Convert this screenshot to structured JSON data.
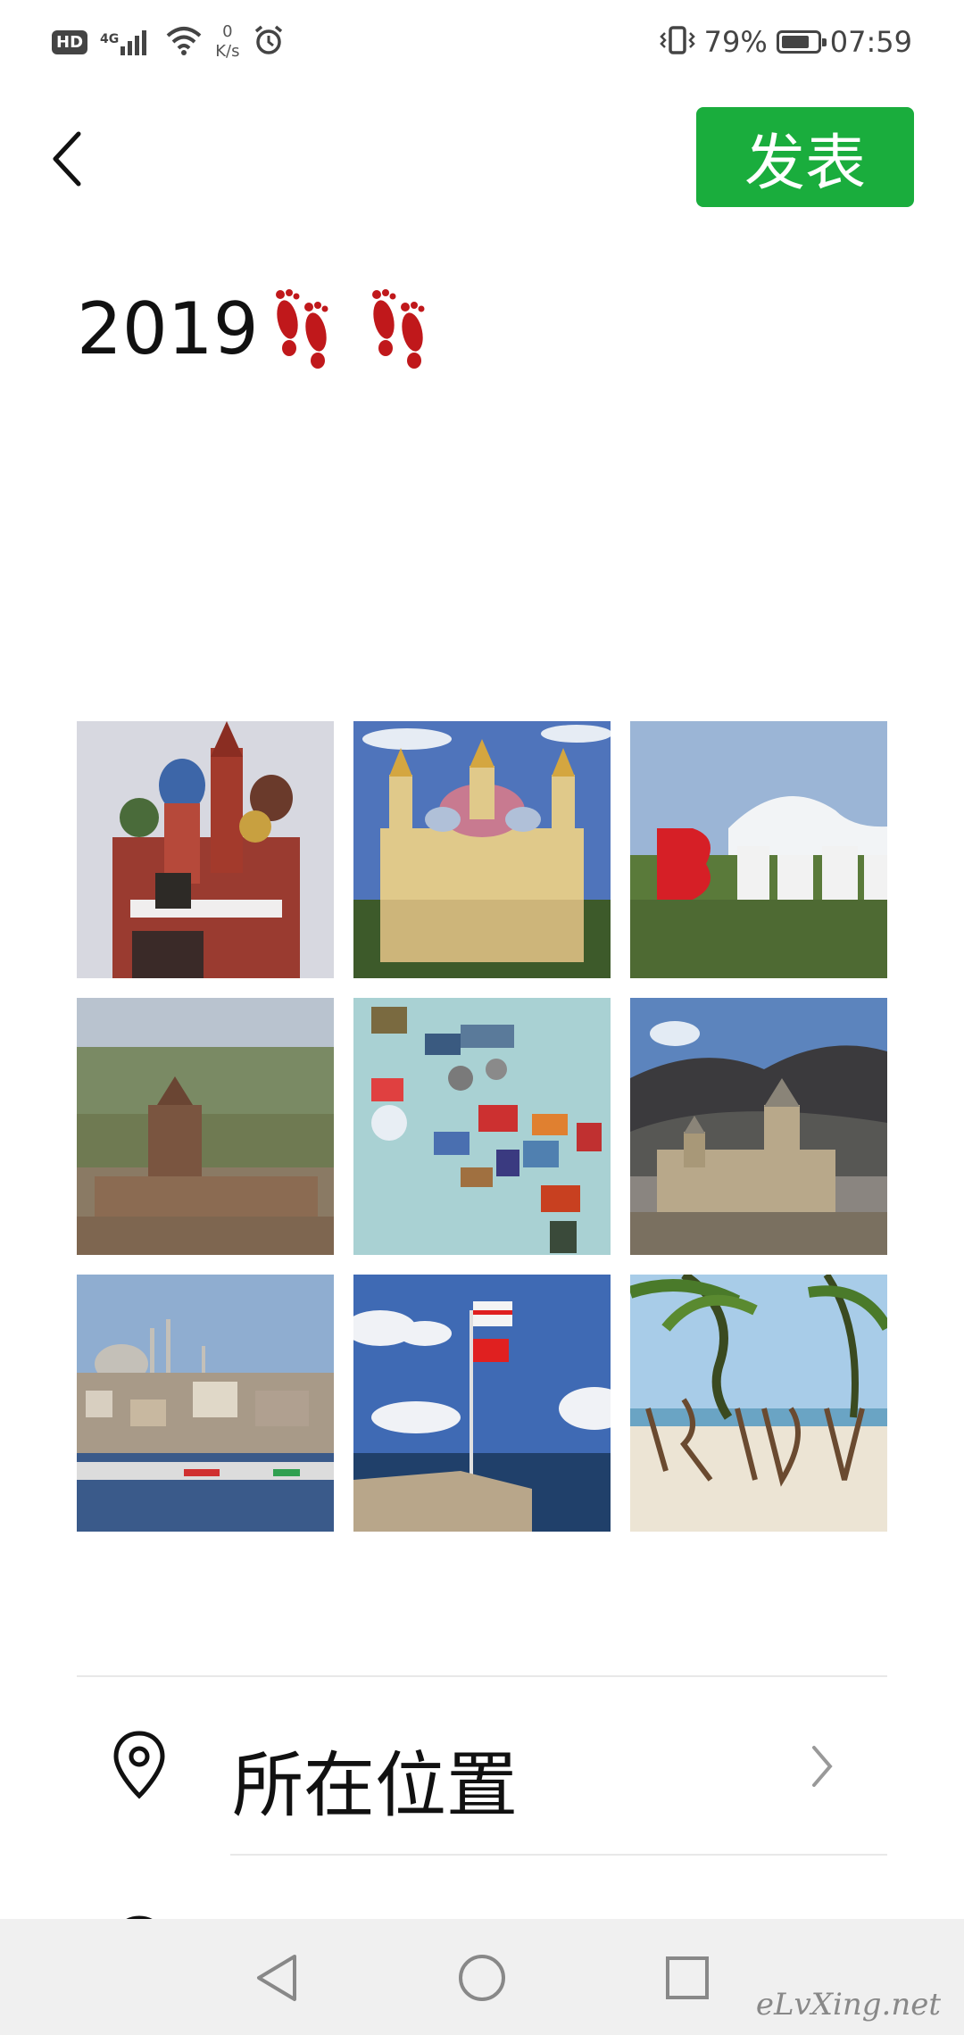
{
  "status_bar": {
    "hd": "HD",
    "network": "4G",
    "speed_value": "0",
    "speed_unit": "K/s",
    "battery_percent_text": "79%",
    "battery_level": 0.79,
    "time": "07:59",
    "icons": [
      "hd-icon",
      "signal-icon",
      "wifi-icon",
      "alarm-icon",
      "vibrate-icon",
      "battery-icon"
    ]
  },
  "header": {
    "back_icon": "chevron-left-icon",
    "publish_label": "发表",
    "publish_color": "#1aad3d"
  },
  "post": {
    "text": "2019",
    "emoji": "footprints-icon"
  },
  "photos": [
    {
      "subject": "Saint Basil's Cathedral"
    },
    {
      "subject": "Ascension Cathedral"
    },
    {
      "subject": "Baku sign"
    },
    {
      "subject": "Monastery on plain"
    },
    {
      "subject": "Fridge magnets"
    },
    {
      "subject": "Fortress in mountains"
    },
    {
      "subject": "Istanbul skyline"
    },
    {
      "subject": "Flags on pier"
    },
    {
      "subject": "Beach with palms"
    }
  ],
  "location": {
    "icon": "location-pin-icon",
    "label": "所在位置",
    "chevron": "chevron-right-icon"
  },
  "nav_bar": {
    "icons": [
      "back-triangle-icon",
      "home-circle-icon",
      "recents-square-icon"
    ],
    "watermark": "eLvXing.net"
  }
}
